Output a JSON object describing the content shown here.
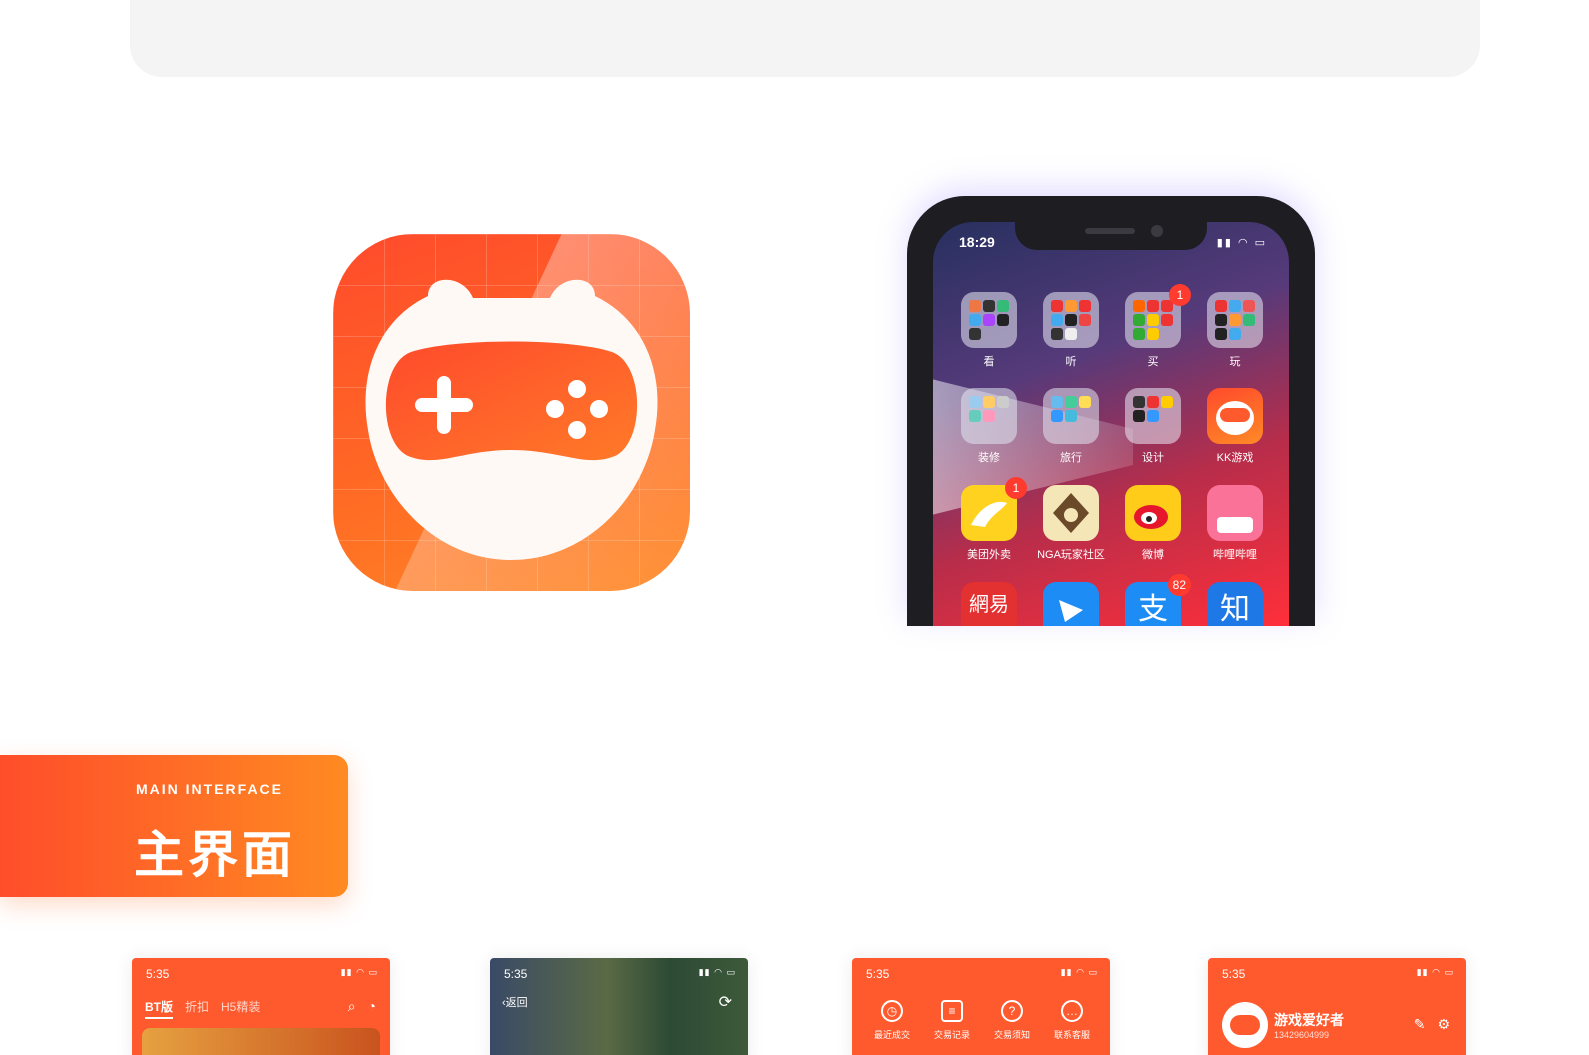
{
  "app_icon": {
    "name": "KK游戏"
  },
  "phone": {
    "time": "18:29",
    "status_icons": "▮▮ ◠ ▭",
    "home_items": [
      {
        "label": "看",
        "badge": ""
      },
      {
        "label": "听",
        "badge": ""
      },
      {
        "label": "买",
        "badge": "1"
      },
      {
        "label": "玩",
        "badge": ""
      },
      {
        "label": "装修",
        "badge": ""
      },
      {
        "label": "旅行",
        "badge": ""
      },
      {
        "label": "设计",
        "badge": ""
      },
      {
        "label": "KK游戏",
        "badge": ""
      },
      {
        "label": "美团外卖",
        "badge": "1"
      },
      {
        "label": "NGA玩家社区",
        "badge": ""
      },
      {
        "label": "微博",
        "badge": ""
      },
      {
        "label": "哔哩哔哩",
        "badge": ""
      },
      {
        "label": "網易",
        "badge": ""
      },
      {
        "label": "",
        "badge": ""
      },
      {
        "label": "支",
        "badge": "82"
      },
      {
        "label": "知",
        "badge": ""
      }
    ]
  },
  "section": {
    "subtitle": "MAIN INTERFACE",
    "title": "主界面"
  },
  "screens": {
    "s1": {
      "time": "5:35",
      "tabs": [
        "BT版",
        "折扣",
        "H5精装"
      ]
    },
    "s2": {
      "time": "5:35",
      "back": "返回"
    },
    "s3": {
      "time": "5:35",
      "items": [
        "最近成交",
        "交易记录",
        "交易须知",
        "联系客服"
      ]
    },
    "s4": {
      "time": "5:35",
      "username": "游戏爱好者",
      "phone": "13429604999"
    }
  },
  "colors": {
    "accent": "#ff5a2e",
    "accent_light": "#ff8a22"
  }
}
